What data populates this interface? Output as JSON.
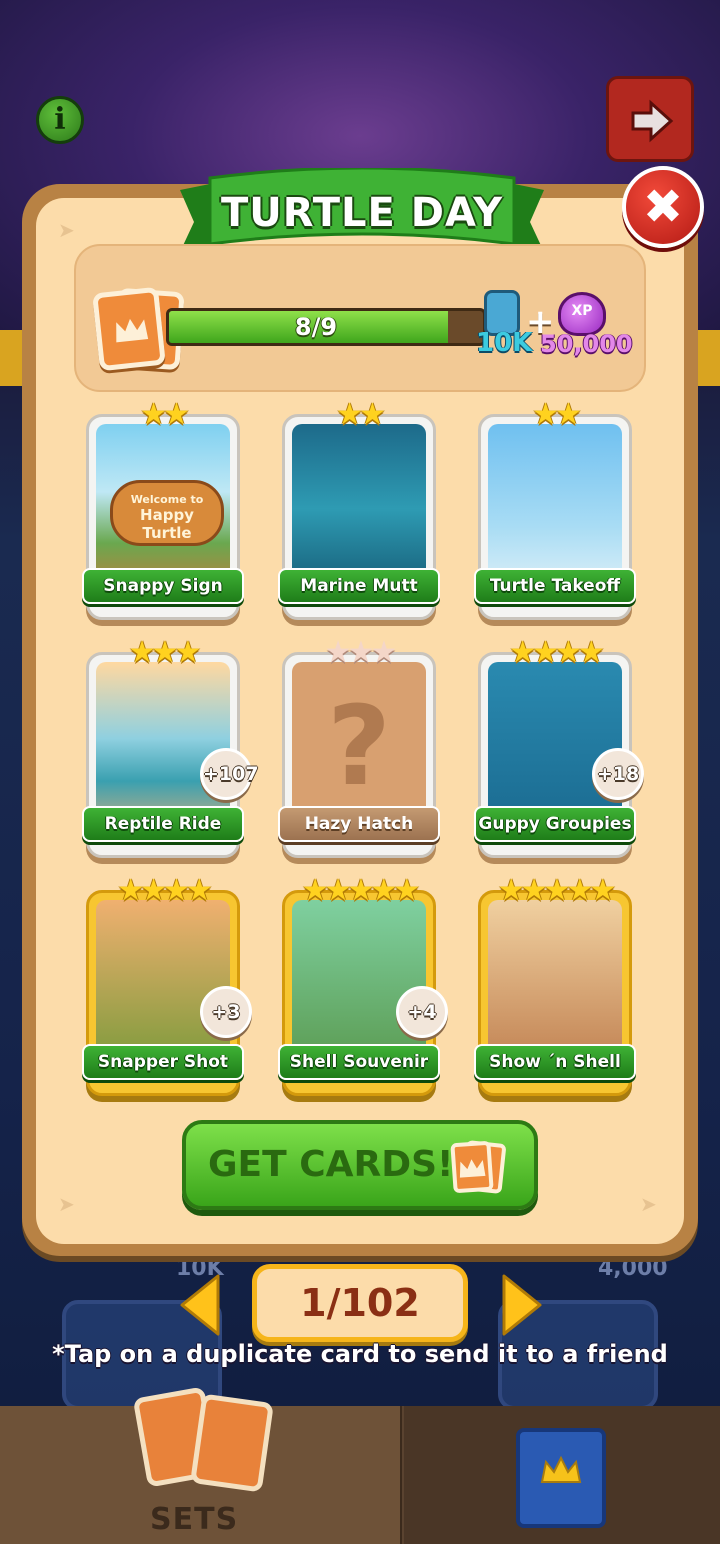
{
  "popup": {
    "title": "TURTLE DAY",
    "progress": {
      "text": "8/9",
      "collected": 8,
      "total": 9
    },
    "rewards": {
      "coins": "10K",
      "plus": "+",
      "xp_label": "XP",
      "xp": "50,000"
    }
  },
  "cards": [
    {
      "name": "Snappy Sign",
      "stars": 2,
      "style": "silver",
      "collected": true,
      "duplicates": ""
    },
    {
      "name": "Marine Mutt",
      "stars": 2,
      "style": "silver",
      "collected": true,
      "duplicates": ""
    },
    {
      "name": "Turtle Takeoff",
      "stars": 2,
      "style": "silver",
      "collected": true,
      "duplicates": ""
    },
    {
      "name": "Reptile Ride",
      "stars": 3,
      "style": "silver",
      "collected": true,
      "duplicates": "+107"
    },
    {
      "name": "Hazy Hatch",
      "stars": 3,
      "style": "missing",
      "collected": false,
      "duplicates": ""
    },
    {
      "name": "Guppy Groupies",
      "stars": 4,
      "style": "silver",
      "collected": true,
      "duplicates": "+18"
    },
    {
      "name": "Snapper Shot",
      "stars": 4,
      "style": "gold",
      "collected": true,
      "duplicates": "+3"
    },
    {
      "name": "Shell Souvenir",
      "stars": 5,
      "style": "gold",
      "collected": true,
      "duplicates": "+4"
    },
    {
      "name": "Show ´n Shell",
      "stars": 5,
      "style": "gold",
      "collected": true,
      "duplicates": ""
    }
  ],
  "card_art": {
    "snappy_sign_text_1": "Welcome to",
    "snappy_sign_text_2": "Happy Turtle",
    "missing_symbol": "?"
  },
  "buttons": {
    "get_cards": "GET CARDS!",
    "close": "✖"
  },
  "pager": {
    "label": "1/102"
  },
  "hint": "*Tap on a duplicate card to send it to a friend",
  "background": {
    "info": "i",
    "amount_left": "10K",
    "amount_right": "4,000"
  },
  "tabs": {
    "sets": "SETS"
  },
  "colors": {
    "accent_green": "#3fb235",
    "panel": "#fcdcaa",
    "gold": "#f7c631",
    "close_red": "#d82a20"
  }
}
